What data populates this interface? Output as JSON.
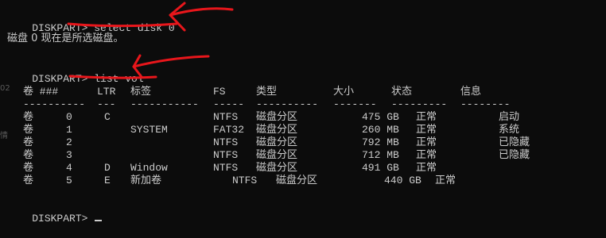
{
  "prompt": "DISKPART>",
  "cmd1": "select disk 0",
  "msg1": "磁盘 0 现在是所选磁盘。",
  "cmd2": "list vol",
  "headers": {
    "vol": "卷 ###",
    "ltr": "LTR",
    "label": "标签",
    "fs": "FS",
    "type": "类型",
    "size": "大小",
    "status": "状态",
    "info": "信息"
  },
  "separators": {
    "vol": "----------",
    "ltr": "---",
    "label": "-----------",
    "fs": "-----",
    "type": "----------",
    "size": "-------",
    "status": "---------",
    "info": "--------"
  },
  "volumes": [
    {
      "vol": "卷",
      "num": "0",
      "ltr": "C",
      "label": "",
      "fs": "NTFS",
      "type": "磁盘分区",
      "size": "475 GB",
      "status": "正常",
      "info": "启动"
    },
    {
      "vol": "卷",
      "num": "1",
      "ltr": "",
      "label": "SYSTEM",
      "fs": "FAT32",
      "type": "磁盘分区",
      "size": "260 MB",
      "status": "正常",
      "info": "系统"
    },
    {
      "vol": "卷",
      "num": "2",
      "ltr": "",
      "label": "",
      "fs": "NTFS",
      "type": "磁盘分区",
      "size": "792 MB",
      "status": "正常",
      "info": "已隐藏"
    },
    {
      "vol": "卷",
      "num": "3",
      "ltr": "",
      "label": "",
      "fs": "NTFS",
      "type": "磁盘分区",
      "size": "712 MB",
      "status": "正常",
      "info": "已隐藏"
    },
    {
      "vol": "卷",
      "num": "4",
      "ltr": "D",
      "label": "Window",
      "fs": "NTFS",
      "type": "磁盘分区",
      "size": "491 GB",
      "status": "正常",
      "info": ""
    },
    {
      "vol": "卷",
      "num": "5",
      "ltr": "E",
      "label": "新加卷",
      "fs": "NTFS",
      "type": "磁盘分区",
      "size": "440 GB",
      "status": "正常",
      "info": ""
    }
  ],
  "prompt_final": "DISKPART>",
  "annotation_color": "#e8161b",
  "left_edge_glyphs": [
    "02",
    "情"
  ]
}
